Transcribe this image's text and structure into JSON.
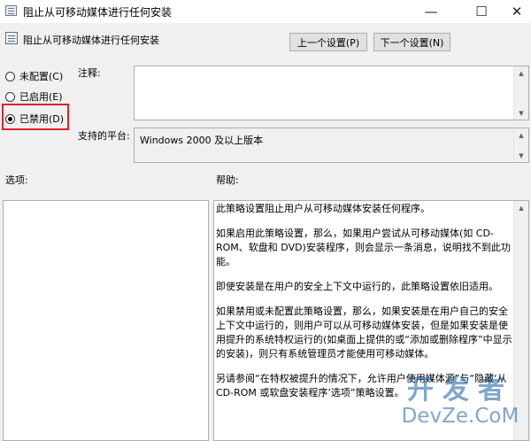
{
  "window": {
    "title": "阻止从可移动媒体进行任何安装",
    "minimize": "—",
    "maximize": "☐",
    "close": "✕"
  },
  "policy": {
    "name": "阻止从可移动媒体进行任何安装",
    "prev_button": "上一个设置(P)",
    "next_button": "下一个设置(N)"
  },
  "state": {
    "options": [
      {
        "label": "未配置(C)",
        "checked": false
      },
      {
        "label": "已启用(E)",
        "checked": false
      },
      {
        "label": "已禁用(D)",
        "checked": true
      }
    ]
  },
  "comment": {
    "label": "注释:",
    "value": ""
  },
  "supported": {
    "label": "支持的平台:",
    "value": "Windows 2000 及以上版本"
  },
  "options_label": "选项:",
  "help": {
    "label": "帮助:",
    "paragraphs": [
      "此策略设置阻止用户从可移动媒体安装任何程序。",
      "如果启用此策略设置，那么，如果用户尝试从可移动媒体(如 CD-ROM、软盘和 DVD)安装程序，则会显示一条消息，说明找不到此功能。",
      "即使安装是在用户的安全上下文中运行的，此策略设置依旧适用。",
      "如果禁用或未配置此策略设置，那么，如果安装是在用户自己的安全上下文中运行的，则用户可以从可移动媒体安装，但是如果安装是使用提升的系统特权运行的(如桌面上提供的或“添加或删除程序”中显示的安装)，则只有系统管理员才能使用可移动媒体。",
      "另请参阅“在特权被提升的情况下，允许用户使用媒体源”与“隐藏‘从 CD-ROM 或软盘安装程序’选项”策略设置。"
    ]
  },
  "watermark": {
    "cn": "开发者",
    "en": "DevZe.CoM"
  },
  "colors": {
    "highlight": "#d9242a",
    "watermark": "#1a5fa3"
  }
}
